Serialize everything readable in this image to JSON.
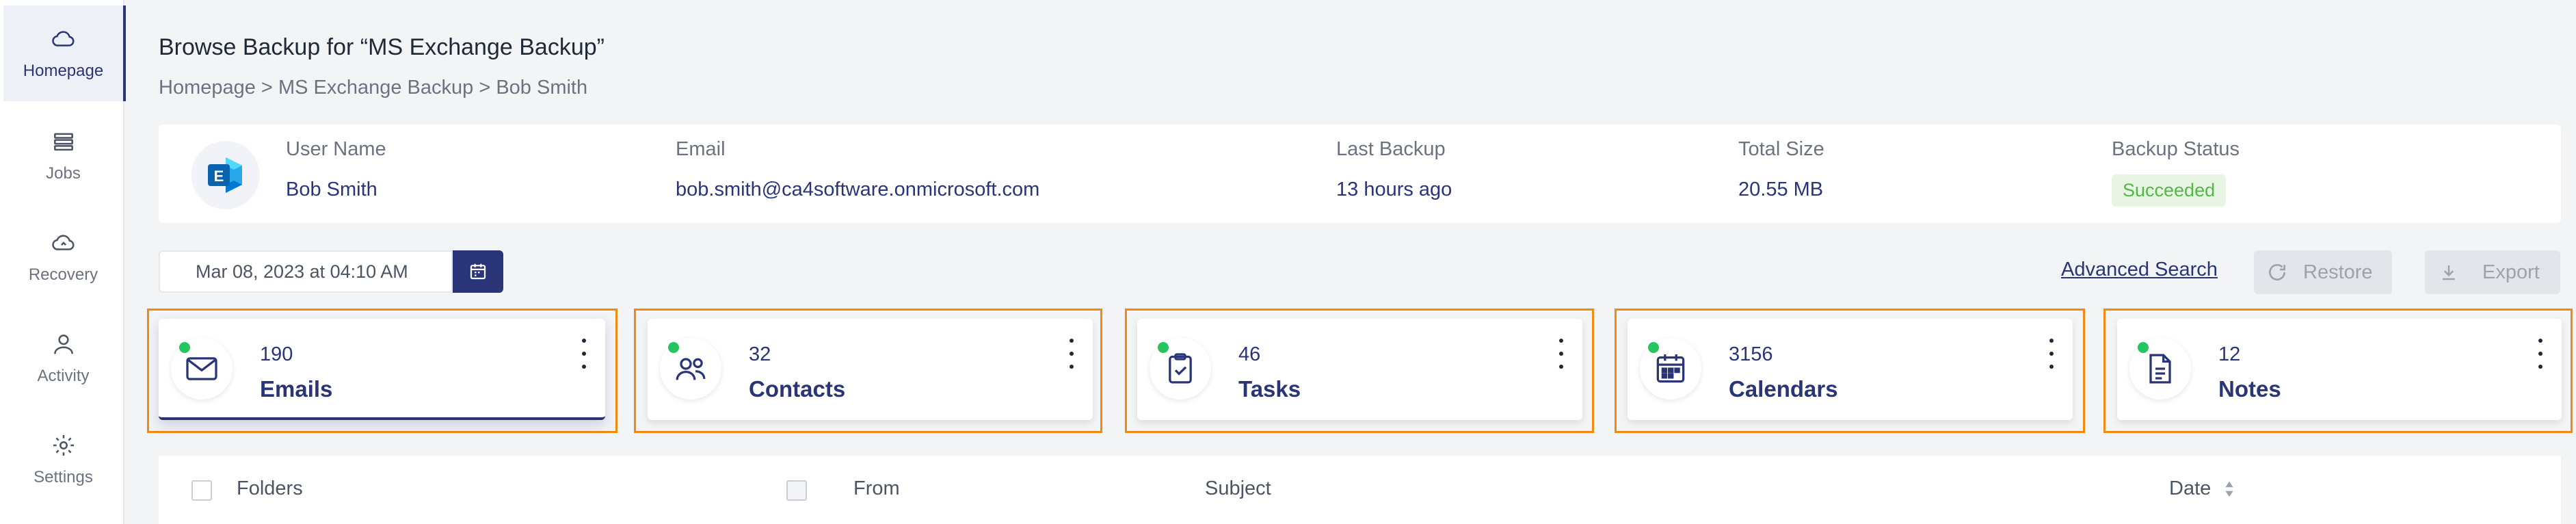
{
  "sidebar": {
    "items": [
      {
        "label": "Homepage",
        "icon": "cloud-icon",
        "active": true
      },
      {
        "label": "Jobs",
        "icon": "list-icon"
      },
      {
        "label": "Recovery",
        "icon": "cloud-restore-icon"
      },
      {
        "label": "Activity",
        "icon": "user-icon"
      },
      {
        "label": "Settings",
        "icon": "gear-icon"
      }
    ]
  },
  "header": {
    "title": "Browse Backup for “MS Exchange Backup”",
    "breadcrumb": [
      "Homepage",
      " > ",
      "MS Exchange Backup",
      " > ",
      "Bob Smith"
    ]
  },
  "user_info": {
    "user_name_label": "User Name",
    "user_name": "Bob Smith",
    "email_label": "Email",
    "email": "bob.smith@ca4software.onmicrosoft.com",
    "last_backup_label": "Last Backup",
    "last_backup": "13 hours ago",
    "total_size_label": "Total Size",
    "total_size": "20.55 MB",
    "status_label": "Backup Status",
    "status": "Succeeded"
  },
  "toolbar": {
    "date_value": "Mar 08, 2023 at 04:10 AM",
    "advanced_search": "Advanced Search",
    "restore_label": "Restore",
    "export_label": "Export"
  },
  "cards": [
    {
      "count": "190",
      "label": "Emails",
      "icon": "envelope-icon",
      "active": true
    },
    {
      "count": "32",
      "label": "Contacts",
      "icon": "people-icon"
    },
    {
      "count": "46",
      "label": "Tasks",
      "icon": "clipboard-check-icon"
    },
    {
      "count": "3156",
      "label": "Calendars",
      "icon": "calendar-icon"
    },
    {
      "count": "12",
      "label": "Notes",
      "icon": "document-icon"
    }
  ],
  "table": {
    "columns": [
      "Folders",
      "From",
      "Subject",
      "Date"
    ]
  },
  "colors": {
    "accent": "#2a3578",
    "success": "#52b843",
    "highlight": "#f08a13"
  }
}
